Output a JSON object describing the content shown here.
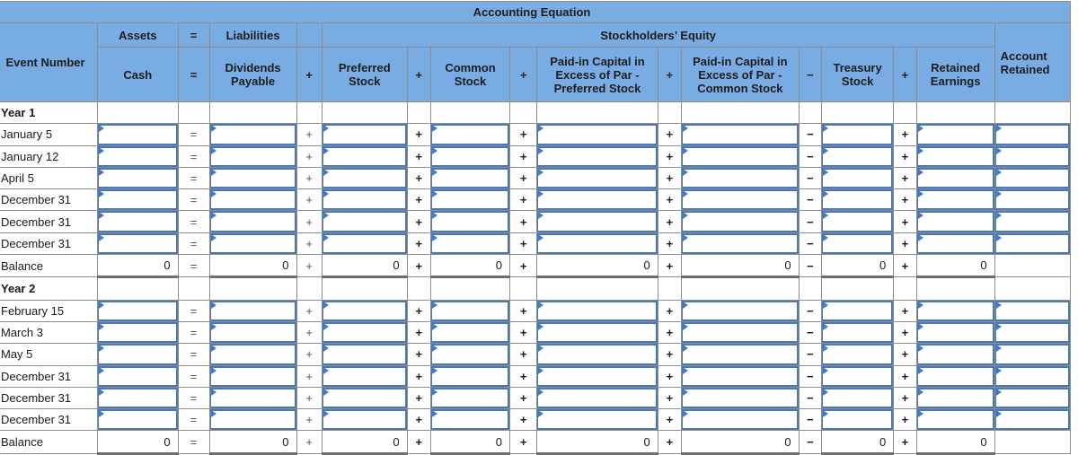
{
  "table": {
    "title": "Accounting Equation",
    "group_headers": {
      "assets": "Assets",
      "equals": "=",
      "liabilities": "Liabilities",
      "stockholders_equity": "Stockholders’ Equity"
    },
    "event_header": "Event Number",
    "right_header": "Account Retained",
    "columns": [
      {
        "key": "cash",
        "label": "Cash"
      },
      {
        "key": "dividends_payable",
        "label": "Dividends Payable"
      },
      {
        "key": "preferred_stock",
        "label": "Preferred Stock"
      },
      {
        "key": "common_stock",
        "label": "Common Stock"
      },
      {
        "key": "pic_preferred",
        "label": "Paid-in Capital in Excess of Par - Preferred Stock"
      },
      {
        "key": "pic_common",
        "label": "Paid-in Capital in Excess of Par - Common Stock"
      },
      {
        "key": "treasury_stock",
        "label": "Treasury Stock"
      },
      {
        "key": "retained_earnings",
        "label": "Retained Earnings"
      }
    ],
    "operators": [
      "=",
      "+",
      "+",
      "+",
      "+",
      "−",
      "+"
    ],
    "sections": [
      {
        "label": "Year 1",
        "events": [
          "January 5",
          "January 12",
          "April 5",
          "December 31",
          "December 31",
          "December 31"
        ],
        "balance_label": "Balance",
        "balance_values": [
          "0",
          "0",
          "0",
          "0",
          "0",
          "0",
          "0",
          "0"
        ]
      },
      {
        "label": "Year 2",
        "events": [
          "February 15",
          "March 3",
          "May 5",
          "December 31",
          "December 31",
          "December 31"
        ],
        "balance_label": "Balance",
        "balance_values": [
          "0",
          "0",
          "0",
          "0",
          "0",
          "0",
          "0",
          "0"
        ]
      }
    ]
  },
  "colors": {
    "header_bg": "#7aace4",
    "input_border": "#4a78b4",
    "input_flag": "#3f7bc8",
    "group_underline": "#26466e"
  }
}
